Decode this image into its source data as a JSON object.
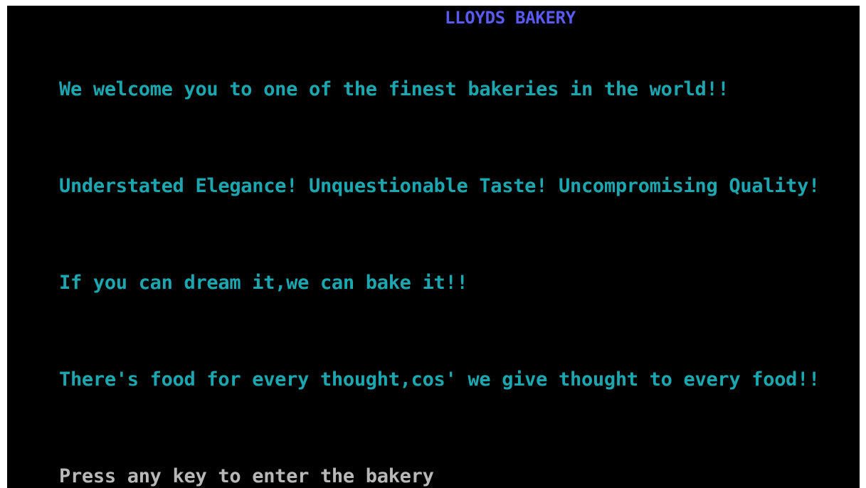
{
  "screen": {
    "title": "LLOYDS BAKERY",
    "lines": [
      "We welcome you to one of the finest bakeries in the world!!",
      "Understated Elegance! Unquestionable Taste! Uncompromising Quality!",
      "If you can dream it,we can bake it!!",
      "There's food for every thought,cos' we give thought to every food!!"
    ],
    "prompt": "Press any key to enter the bakery"
  },
  "colors": {
    "background": "#000000",
    "title": "#5a5af0",
    "text": "#1ca7b0",
    "prompt": "#b8b8b8"
  }
}
